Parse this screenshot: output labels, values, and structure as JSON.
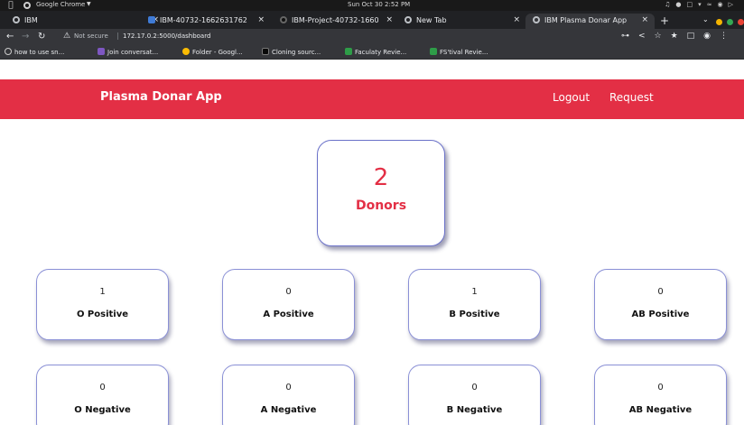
{
  "os": {
    "app_name": "Google Chrome",
    "clock": "Sun Oct 30  2:52 PM"
  },
  "tabs": [
    {
      "label": "IBM",
      "active": false
    },
    {
      "label": "IBM-40732-1662631762",
      "active": false
    },
    {
      "label": "IBM-Project-40732-1660",
      "active": false
    },
    {
      "label": "New Tab",
      "active": false
    },
    {
      "label": "IBM Plasma Donar App",
      "active": true
    }
  ],
  "address": {
    "security": "Not secure",
    "url": "172.17.0.2:5000/dashboard"
  },
  "bookmarks": [
    "how to use sn...",
    "Join conversat...",
    "Folder - Googl...",
    "Cloning sourc...",
    "Faculaty Revie...",
    "FS'tival Revie..."
  ],
  "navbar": {
    "brand": "Plasma Donar App",
    "logout": "Logout",
    "request": "Request",
    "color": "#e32f45"
  },
  "summary": {
    "count": "2",
    "label": "Donors"
  },
  "blood_groups": [
    {
      "count": "1",
      "group": "O Positive"
    },
    {
      "count": "0",
      "group": "A Positive"
    },
    {
      "count": "1",
      "group": "B Positive"
    },
    {
      "count": "0",
      "group": "AB Positive"
    },
    {
      "count": "0",
      "group": "O Negative"
    },
    {
      "count": "0",
      "group": "A Negative"
    },
    {
      "count": "0",
      "group": "B Negative"
    },
    {
      "count": "0",
      "group": "AB Negative"
    }
  ]
}
